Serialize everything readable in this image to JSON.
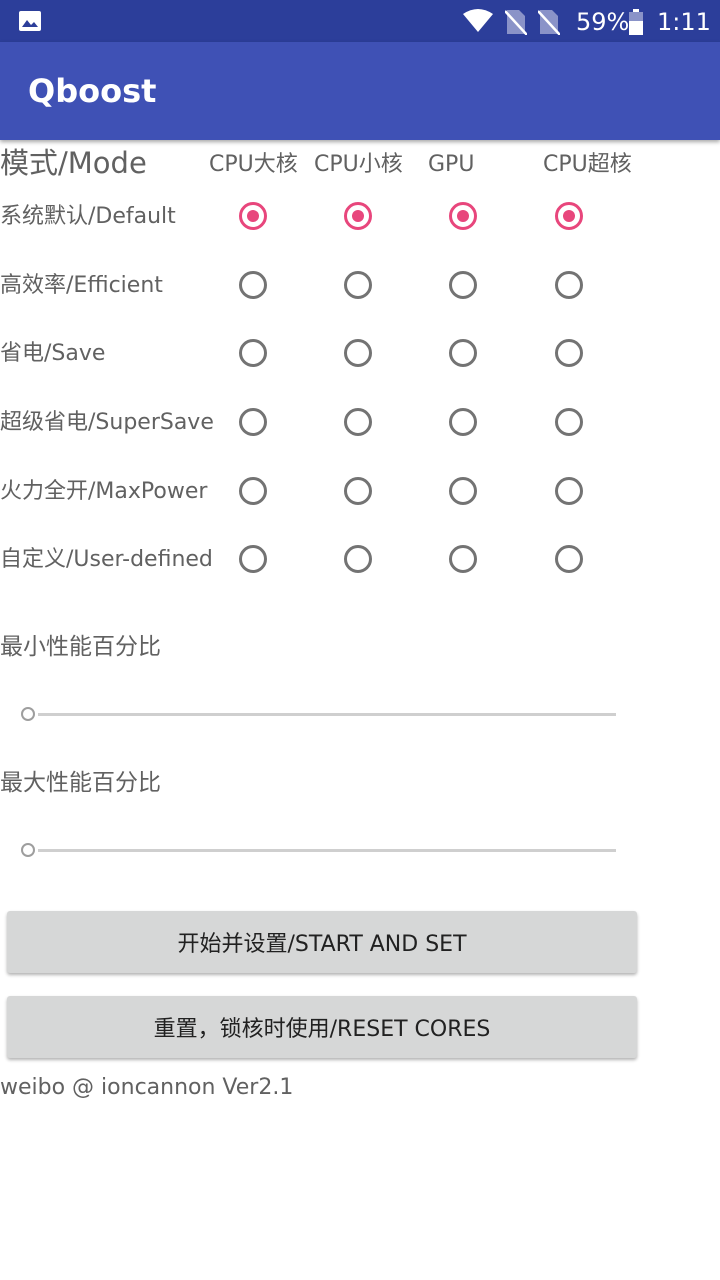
{
  "status_bar": {
    "battery": "59%",
    "time": "1:11",
    "icons": [
      "image-icon",
      "wifi-icon",
      "no-sim-icon",
      "no-sim-icon",
      "battery-icon"
    ]
  },
  "app_bar": {
    "title": "Qboost"
  },
  "mode_header": "模式/Mode",
  "columns": [
    "CPU大核",
    "CPU小核",
    "GPU",
    "CPU超核"
  ],
  "modes": [
    {
      "label": "系统默认/Default",
      "selected": true
    },
    {
      "label": "高效率/Efficient",
      "selected": false
    },
    {
      "label": "省电/Save",
      "selected": false
    },
    {
      "label": "超级省电/SuperSave",
      "selected": false
    },
    {
      "label": "火力全开/MaxPower",
      "selected": false
    },
    {
      "label": "自定义/User-defined",
      "selected": false
    }
  ],
  "sliders": [
    {
      "label": "最小性能百分比",
      "value_fraction": 0
    },
    {
      "label": "最大性能百分比",
      "value_fraction": 0
    }
  ],
  "buttons": {
    "start": "开始并设置/START AND SET",
    "reset": "重置，锁核时使用/RESET CORES"
  },
  "footer": "weibo @ ioncannon Ver2.1",
  "colors": {
    "status_bar": "#2c3e9a",
    "app_bar": "#3f51b5",
    "radio_checked": "#e8467c",
    "radio_unchecked": "#737373",
    "button_bg": "#d6d7d7"
  }
}
